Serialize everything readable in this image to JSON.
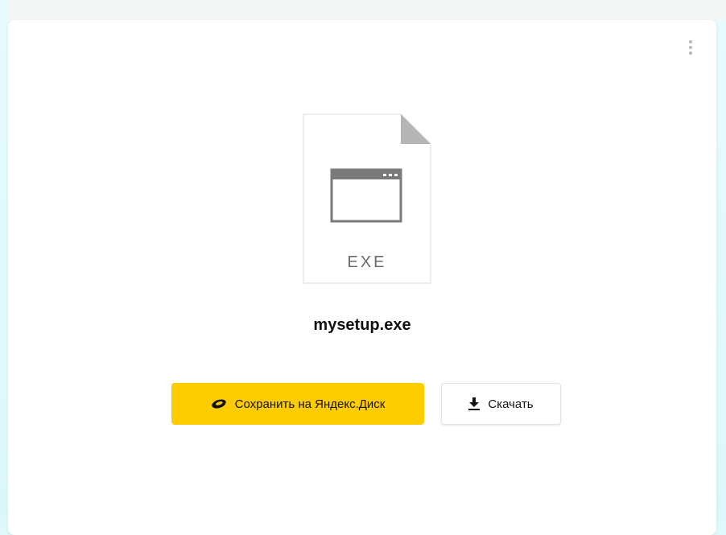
{
  "file": {
    "name": "mysetup.exe",
    "extension": "EXE"
  },
  "actions": {
    "save_label": "Сохранить на Яндекс.Диск",
    "download_label": "Скачать"
  },
  "menu": {
    "icon": "more-vertical-icon"
  },
  "colors": {
    "save_button": "#ffcc00",
    "card": "#ffffff",
    "background": "#dff8fb"
  }
}
